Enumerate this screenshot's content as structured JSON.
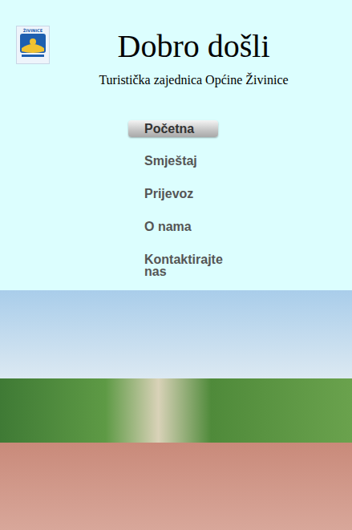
{
  "logo": {
    "text": "ŽIVINICE"
  },
  "header": {
    "title": "Dobro došli",
    "subtitle": "Turistička zajednica Općine Živinice"
  },
  "nav": [
    {
      "label": "Početna",
      "selected": true
    },
    {
      "label": "Smještaj",
      "selected": false
    },
    {
      "label": "Prijevoz",
      "selected": false
    },
    {
      "label": "O nama",
      "selected": false
    },
    {
      "label": "Kontaktirajte nas",
      "selected": false
    }
  ]
}
